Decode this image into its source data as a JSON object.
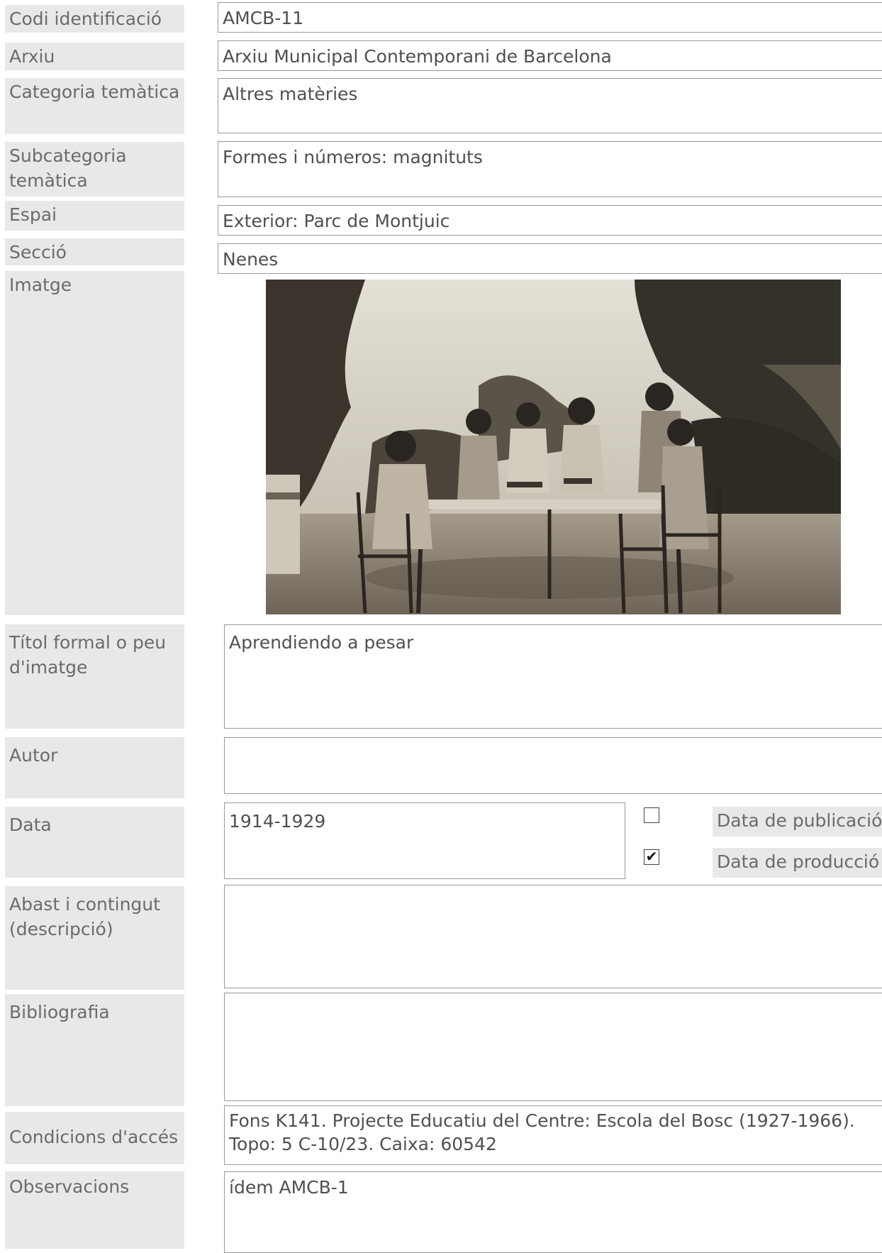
{
  "fields": {
    "codi_label": "Codi identificació",
    "codi_value": "AMCB-11",
    "arxiu_label": "Arxiu",
    "arxiu_value": "Arxiu Municipal Contemporani de Barcelona",
    "categoria_label": "Categoria temàtica",
    "categoria_value": "Altres matèries",
    "subcategoria_label": "Subcategoria temàtica",
    "subcategoria_value": "Formes i números: magnituts",
    "espai_label": "Espai",
    "espai_value": "Exterior: Parc de Montjuic",
    "seccio_label": "Secció",
    "seccio_value": "Nenes",
    "imatge_label": "Imatge",
    "titol_label": "Títol formal o peu d'imatge",
    "titol_value": "Aprendiendo a pesar",
    "autor_label": "Autor",
    "autor_value": "",
    "data_label": "Data",
    "data_value": "1914-1929",
    "data_publicacio_label": "Data de publicació",
    "data_publicacio_checked": false,
    "data_produccio_label": "Data de producció",
    "data_produccio_checked": true,
    "abast_label": "Abast i contingut (descripció)",
    "abast_value": "",
    "bibliografia_label": "Bibliografia",
    "bibliografia_value": "",
    "condicions_label": "Condicions d'accés",
    "condicions_value": "Fons K141. Projecte Educatiu del Centre: Escola del Bosc (1927-1966). Topo: 5 C-10/23. Caixa: 60542",
    "observacions_label": "Observacions",
    "observacions_value": "ídem AMCB-1"
  },
  "image": {
    "icon": "sepia-photo-children-weighing-at-table",
    "colors": {
      "sky": "#d9d4c8",
      "foliage": "#3a342c",
      "ground": "#8c8274"
    }
  }
}
